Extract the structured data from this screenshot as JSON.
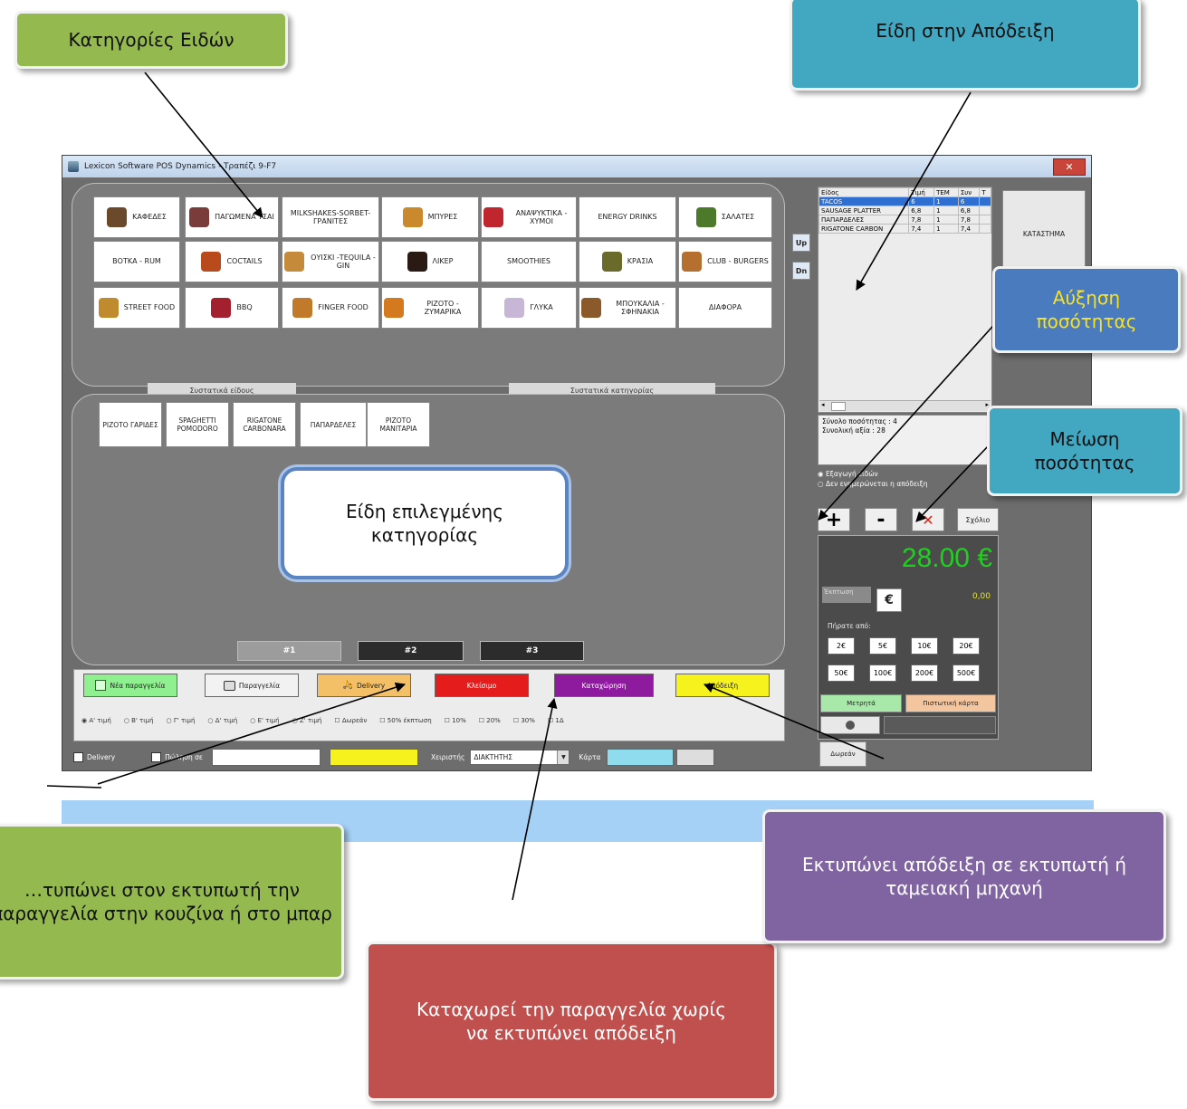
{
  "window": {
    "title": "Lexicon Software POS Dynamics - Τραπέζι 9-F7",
    "close_label": "✕"
  },
  "categories": [
    {
      "label": "ΚΑΦΕΔΕΣ",
      "icon": "coffee-icon",
      "color": "#6b4a2b"
    },
    {
      "label": "ΠΑΓΩΜΕΝΑ ΤΣΑΙ",
      "icon": "iced-tea-icon",
      "color": "#7a3b3b"
    },
    {
      "label": "MILKSHAKES-SORBET-ΓΡΑΝΙΤΕΣ",
      "icon": "",
      "color": ""
    },
    {
      "label": "ΜΠΥΡΕΣ",
      "icon": "beer-icon",
      "color": "#c9892c"
    },
    {
      "label": "ΑΝΑΨΥΚΤΙΚΑ - ΧΥΜΟΙ",
      "icon": "soda-icon",
      "color": "#c0262d"
    },
    {
      "label": "ENERGY DRINKS",
      "icon": "",
      "color": ""
    },
    {
      "label": "ΣΑΛΑΤΕΣ",
      "icon": "salad-icon",
      "color": "#4c7a2a"
    },
    {
      "label": "ΒΟΤΚΑ - RUM",
      "icon": "",
      "color": ""
    },
    {
      "label": "COCTAILS",
      "icon": "cocktail-icon",
      "color": "#b84a1c"
    },
    {
      "label": "ΟΥΙΣΚΙ -TEQUILA - GIN",
      "icon": "whisky-icon",
      "color": "#c58b3a"
    },
    {
      "label": "ΛΙΚΕΡ",
      "icon": "liqueur-icon",
      "color": "#2a1a14"
    },
    {
      "label": "SMOOTHIES",
      "icon": "",
      "color": ""
    },
    {
      "label": "ΚΡΑΣΙΑ",
      "icon": "wine-icon",
      "color": "#6a6a2a"
    },
    {
      "label": "CLUB - BURGERS",
      "icon": "burger-icon",
      "color": "#b5702f"
    },
    {
      "label": "STREET FOOD",
      "icon": "street-food-icon",
      "color": "#c08a2e"
    },
    {
      "label": "BBQ",
      "icon": "bbq-icon",
      "color": "#a3202f"
    },
    {
      "label": "FINGER FOOD",
      "icon": "finger-food-icon",
      "color": "#c07a2a"
    },
    {
      "label": "ΡΙΖΟΤΟ - ΖΥΜΑΡΙΚΑ",
      "icon": "pasta-icon",
      "color": "#d47a1e"
    },
    {
      "label": "ΓΛΥΚΑ",
      "icon": "dessert-icon",
      "color": "#c8b6d6"
    },
    {
      "label": "ΜΠΟΥΚΑΛΙΑ - ΣΦΗΝΑΚΙΑ",
      "icon": "bottles-icon",
      "color": "#8a5a2a"
    },
    {
      "label": "ΔΙΑΦΟΡΑ",
      "icon": "",
      "color": ""
    }
  ],
  "scroll": {
    "up": "Up",
    "down": "Dn"
  },
  "labels": {
    "item_ingredients": "Συστατικά είδους",
    "category_ingredients": "Συστατικά κατηγορίας"
  },
  "items": [
    {
      "label": "ΡΙΖΟΤΟ ΓΑΡΙΔΕΣ"
    },
    {
      "label": "SPAGHETTI POMODORO"
    },
    {
      "label": "RIGATONE CARBONARA"
    },
    {
      "label": "ΠΑΠΑΡΔΕΛΕΣ"
    },
    {
      "label": "ΡΙΖΟΤΟ ΜΑΝΙΤΑΡΙΑ"
    }
  ],
  "pages": [
    "#1",
    "#2",
    "#3"
  ],
  "actions": {
    "new_order": "Νέα παραγγελία",
    "order": "Παραγγελία",
    "delivery": "Delivery",
    "close": "Κλείσιμο",
    "register": "Καταχώρηση",
    "receipt": "Απόδειξη",
    "new_order_color": "#8ef08e",
    "delivery_color": "#f4c067",
    "close_color": "#e41c1c",
    "register_color": "#8e1a9e",
    "receipt_color": "#f6f21e"
  },
  "price_options": [
    "Α' τιμή",
    "Β' τιμή",
    "Γ' τιμή",
    "Δ' τιμή",
    "Ε' τιμή",
    "Ζ' τιμή",
    "Δωρεάν",
    "50% έκπτωση",
    "10%",
    "20%",
    "30%",
    "1Δ"
  ],
  "footer": {
    "delivery_label": "Delivery",
    "sale_label": "Πώληση σε",
    "cashier_label": "Χειριστής",
    "cashier_value": "ΔΙΑΚΤΗΤΗΣ",
    "card_label": "Κάρτα",
    "yellow_color": "#f6f21e",
    "card_color": "#8fdcee"
  },
  "receipt": {
    "columns": [
      "Είδος",
      "Τιμή",
      "ΤΕΜ",
      "Συν",
      "Τ"
    ],
    "rows": [
      [
        "TACOS",
        "6",
        "1",
        "6",
        ""
      ],
      [
        "SAUSAGE PLATTER",
        "6,8",
        "1",
        "6,8",
        ""
      ],
      [
        "ΠΑΠΑΡΔΕΛΕΣ",
        "7,8",
        "1",
        "7,8",
        ""
      ],
      [
        "RIGATONE CARBON",
        "7,4",
        "1",
        "7,4",
        ""
      ]
    ],
    "summary_qty": "Σύνολο ποσότητας : 4",
    "summary_value": "Συνολική αξία : 28",
    "radio_export": "Εξαγωγή ειδών",
    "radio_no_update": "Δεν ενημερώνεται η απόδειξη"
  },
  "store_button": "ΚΑΤΑΣΤΗΜΑ",
  "controls": {
    "plus": "+",
    "minus": "-",
    "delete": "✕",
    "comment": "Σχόλιο"
  },
  "total": {
    "amount": "28.00 €",
    "discount_label": "Έκπτωση",
    "euro": "€",
    "discount_value": "0,00",
    "payment_label": "Πήρατε από:",
    "notes": [
      "2€",
      "5€",
      "10€",
      "20€",
      "50€",
      "100€",
      "200€",
      "500€"
    ],
    "cash": "Μετρητά",
    "card": "Πιστωτική κάρτα",
    "gift": "Δωρεάν"
  },
  "callouts": {
    "categories": "Κατηγορίες Ειδών",
    "receipt_items": "Είδη στην Απόδειξη",
    "increase": "Αύξηση ποσότητας",
    "decrease": "Μείωση ποσότητας",
    "selected_category": "Είδη επιλεγμένης κατηγορίας",
    "print_order": "…τυπώνει στον εκτυπωτή την παραγγελία στην κουζίνα ή στο μπαρ",
    "register": "Καταχωρεί την παραγγελία χωρίς να εκτυπώνει απόδειξη",
    "print_receipt": "Εκτυπώνει απόδειξη σε εκτυπωτή ή ταμειακή μηχανή"
  }
}
